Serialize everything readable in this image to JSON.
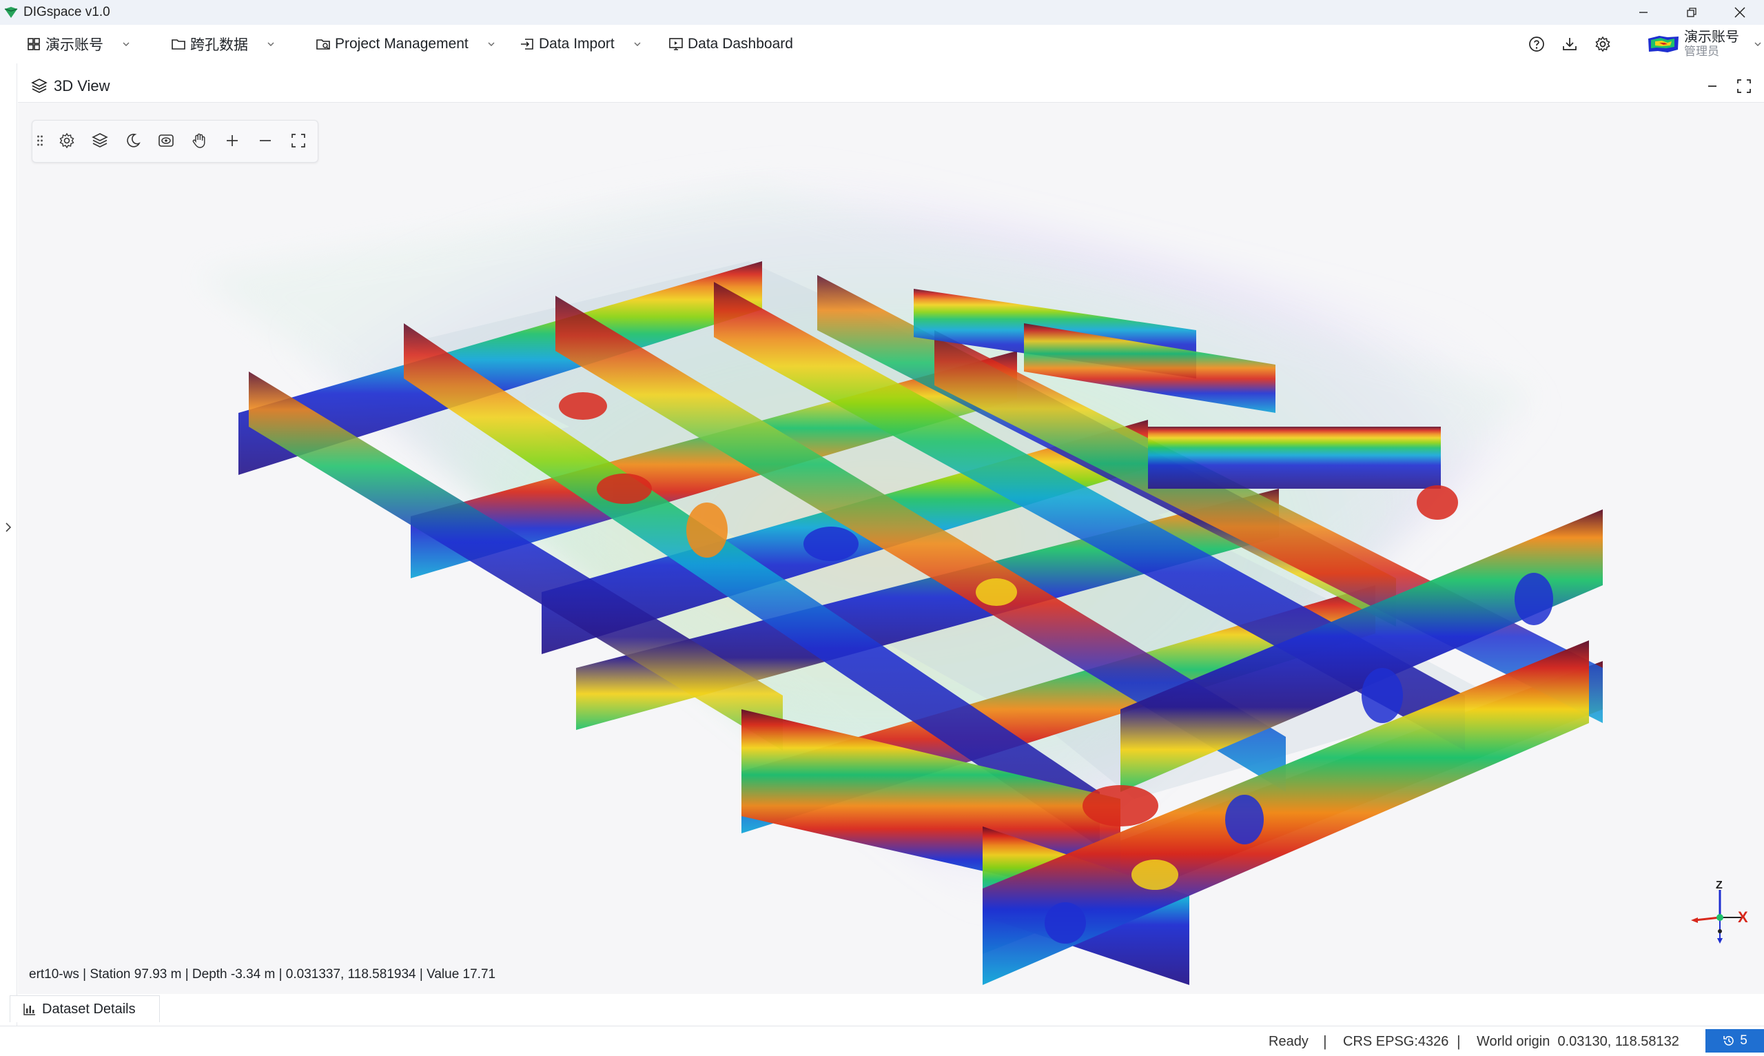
{
  "window": {
    "title": "DIGspace v1.0"
  },
  "menu": {
    "account": "演示账号",
    "crosshole": "跨孔数据",
    "project": "Project Management",
    "import": "Data Import",
    "dashboard": "Data Dashboard"
  },
  "user": {
    "name": "演示账号",
    "role": "管理员"
  },
  "panel": {
    "title": "3D View"
  },
  "toolbar_icons": [
    "drag-handle-icon",
    "settings-icon",
    "layers-icon",
    "moon-icon",
    "camera-eye-icon",
    "hand-pan-icon",
    "zoom-in-icon",
    "zoom-out-icon",
    "fullscreen-icon"
  ],
  "viewport": {
    "readout": "ert10-ws | Station 97.93 m | Depth -3.34 m | 0.031337, 118.581934 | Value 17.71",
    "axis_labels": {
      "z": "Z",
      "x": "X"
    }
  },
  "bottom": {
    "details_tab": "Dataset Details"
  },
  "status": {
    "state": "Ready",
    "crs": "CRS EPSG:4326",
    "origin": "World origin  0.03130, 118.58132",
    "count": "5"
  },
  "colors": {
    "accent": "#1f6fd1",
    "colormap": [
      "#2a1a8c",
      "#1f2fd1",
      "#12a7d8",
      "#1fc16b",
      "#8bd40f",
      "#f2d21b",
      "#f08a1a",
      "#d8281c",
      "#5a0d2a"
    ]
  }
}
